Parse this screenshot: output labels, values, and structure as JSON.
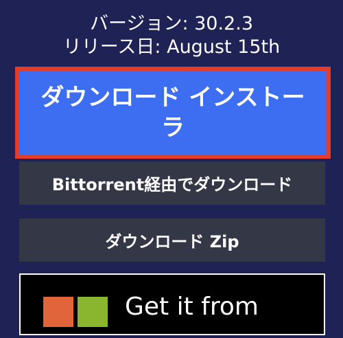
{
  "version_info": {
    "version_line": "バージョン: 30.2.3",
    "release_line": "リリース日: August 15th"
  },
  "downloads": {
    "installer_label": "ダウンロード インストーラ",
    "torrent_label": "Bittorrent経由でダウンロード",
    "zip_label": "ダウンロード Zip"
  },
  "store_badge": {
    "text": "Get it from",
    "icon": "microsoft-logo-icon"
  },
  "colors": {
    "background": "#1f2255",
    "primary_button": "#3d6ef1",
    "highlight_border": "#e53b2a",
    "secondary_button": "#343746"
  }
}
